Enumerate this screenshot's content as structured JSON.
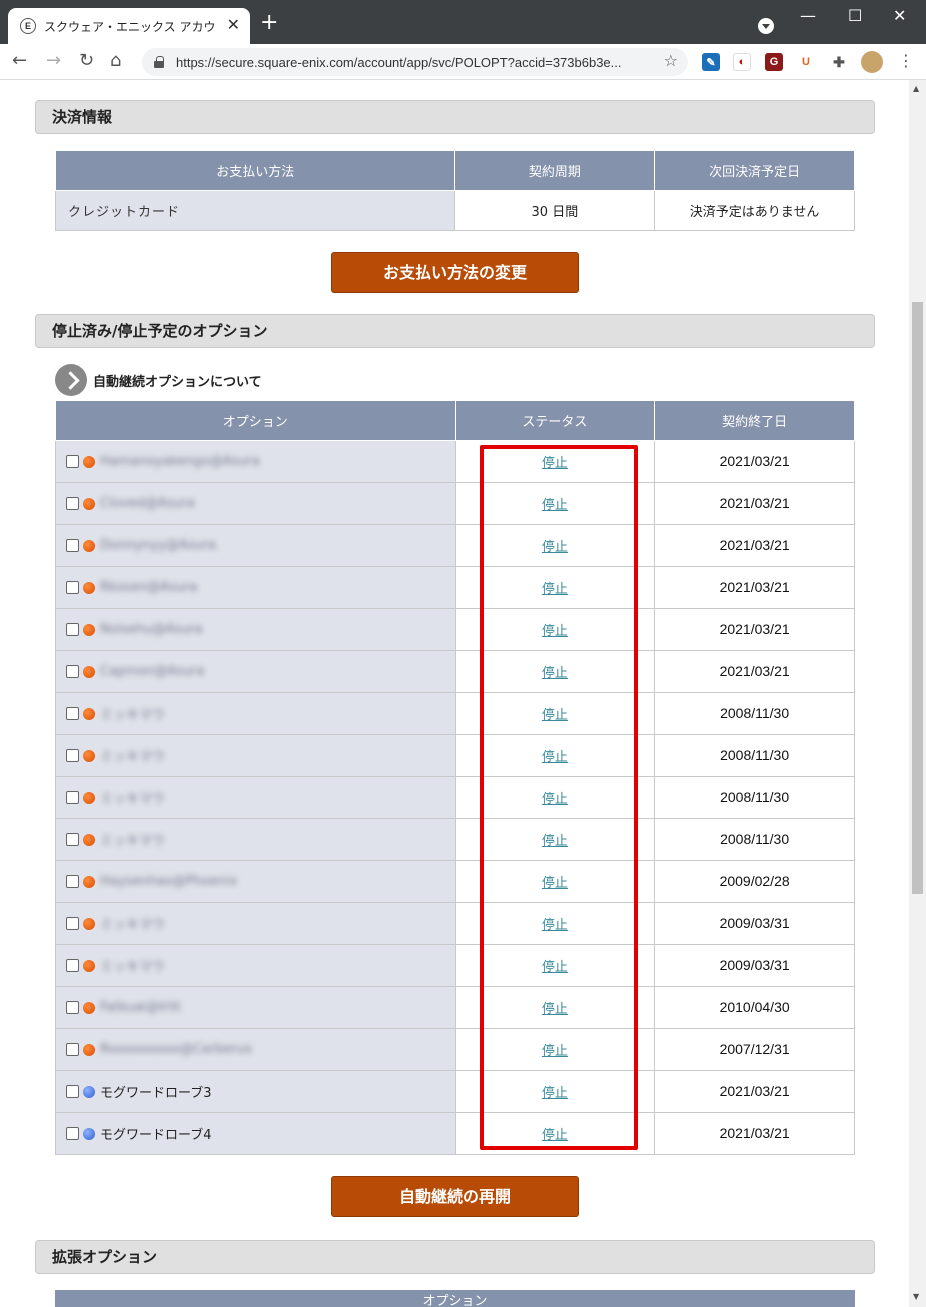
{
  "browser": {
    "tab_title": "スクウェア・エニックス アカウント管理シ",
    "favicon_letter": "E",
    "url": "https://secure.square-enix.com/account/app/svc/POLOPT?accid=373b6b3e..."
  },
  "payment": {
    "section_title": "決済情報",
    "headers": [
      "お支払い方法",
      "契約周期",
      "次回決済予定日"
    ],
    "method": "クレジットカード",
    "cycle": "30 日間",
    "next_date": "決済予定はありません",
    "change_button": "お支払い方法の変更"
  },
  "stopped": {
    "section_title": "停止済み/停止予定のオプション",
    "info_link": "自動継続オプションについて",
    "headers": [
      "オプション",
      "ステータス",
      "契約終了日"
    ],
    "rows": [
      {
        "name": "Hamanoyakengo@Asura",
        "blurred": true,
        "dot": "orange",
        "status": "停止",
        "date": "2021/03/21"
      },
      {
        "name": "Cloved@Asura",
        "blurred": true,
        "dot": "orange",
        "status": "停止",
        "date": "2021/03/21"
      },
      {
        "name": "Donnynyy@Asura",
        "blurred": true,
        "dot": "orange",
        "status": "停止",
        "date": "2021/03/21"
      },
      {
        "name": "Rkosen@Asura",
        "blurred": true,
        "dot": "orange",
        "status": "停止",
        "date": "2021/03/21"
      },
      {
        "name": "Noisehu@Asura",
        "blurred": true,
        "dot": "orange",
        "status": "停止",
        "date": "2021/03/21"
      },
      {
        "name": "Capmon@Asura",
        "blurred": true,
        "dot": "orange",
        "status": "停止",
        "date": "2021/03/21"
      },
      {
        "name": "ミッキマウ",
        "blurred": true,
        "dot": "orange",
        "status": "停止",
        "date": "2008/11/30"
      },
      {
        "name": "ミッキマウ",
        "blurred": true,
        "dot": "orange",
        "status": "停止",
        "date": "2008/11/30"
      },
      {
        "name": "ミッキマウ",
        "blurred": true,
        "dot": "orange",
        "status": "停止",
        "date": "2008/11/30"
      },
      {
        "name": "ミッキマウ",
        "blurred": true,
        "dot": "orange",
        "status": "停止",
        "date": "2008/11/30"
      },
      {
        "name": "Haysenhao@Phoenix",
        "blurred": true,
        "dot": "orange",
        "status": "停止",
        "date": "2009/02/28"
      },
      {
        "name": "ミッキマウ",
        "blurred": true,
        "dot": "orange",
        "status": "停止",
        "date": "2009/03/31"
      },
      {
        "name": "ミッキマウ",
        "blurred": true,
        "dot": "orange",
        "status": "停止",
        "date": "2009/03/31"
      },
      {
        "name": "Fatkuai@Irlit",
        "blurred": true,
        "dot": "orange",
        "status": "停止",
        "date": "2010/04/30"
      },
      {
        "name": "Rooooooooo@Cerberus",
        "blurred": true,
        "dot": "orange",
        "status": "停止",
        "date": "2007/12/31"
      },
      {
        "name": "モグワードローブ3",
        "blurred": false,
        "dot": "blue",
        "status": "停止",
        "date": "2021/03/21"
      },
      {
        "name": "モグワードローブ4",
        "blurred": false,
        "dot": "blue",
        "status": "停止",
        "date": "2021/03/21"
      }
    ],
    "resume_button": "自動継続の再開"
  },
  "extended": {
    "section_title": "拡張オプション",
    "header_partial": "オプション"
  }
}
